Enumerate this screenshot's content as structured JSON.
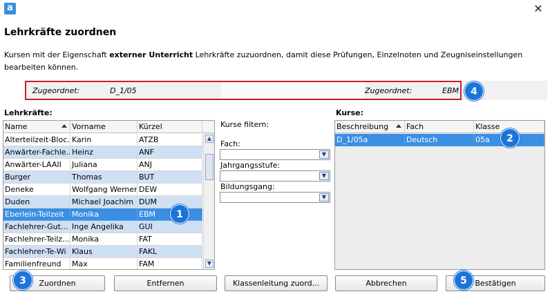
{
  "window": {
    "title": "Lehrkräfte zuordnen",
    "logo_letter": "a",
    "close_symbol": "✕"
  },
  "description": {
    "prefix": "Kursen mit der Eigenschaft ",
    "emphasis": "externer Unterricht",
    "suffix": " Lehrkräfte zuzuordnen, damit diese Prüfungen, Einzelnoten und Zeugniseinstellungen bearbeiten können."
  },
  "assigned": {
    "left_label": "Zugeordnet:",
    "left_value": "D_1/05",
    "right_label": "Zugeordnet:",
    "right_value": "EBM"
  },
  "teachers": {
    "label": "Lehrkräfte:",
    "columns": [
      "Name",
      "Vorname",
      "Kürzel"
    ],
    "rows": [
      {
        "name": "Alterteilzeit-Bloc...",
        "vorname": "Karin",
        "kuerzel": "ATZB"
      },
      {
        "name": "Anwärter-Fachle...",
        "vorname": "Heinz",
        "kuerzel": "ANF"
      },
      {
        "name": "Anwärter-LAAII",
        "vorname": "Juliana",
        "kuerzel": "ANJ"
      },
      {
        "name": "Burger",
        "vorname": "Thomas",
        "kuerzel": "BUT"
      },
      {
        "name": "Deneke",
        "vorname": "Wolfgang Werner",
        "kuerzel": "DEW"
      },
      {
        "name": "Duden",
        "vorname": "Michael Joachim",
        "kuerzel": "DUM"
      },
      {
        "name": "Eberlein-Teilzeit",
        "vorname": "Monika",
        "kuerzel": "EBM"
      },
      {
        "name": "Fachlehrer-Gut...",
        "vorname": "Inge Angelika",
        "kuerzel": "GUI"
      },
      {
        "name": "Fachlehrer-Teilz...",
        "vorname": "Monika",
        "kuerzel": "FAT"
      },
      {
        "name": "Fachlehrer-Te-Wi",
        "vorname": "Klaus",
        "kuerzel": "FAKL"
      },
      {
        "name": "Familienfreund",
        "vorname": "Max",
        "kuerzel": "FAM"
      }
    ],
    "selected_index": 6
  },
  "filters": {
    "title": "Kurse filtern:",
    "fach_label": "Fach:",
    "fach_value": "",
    "jahrgang_label": "Jahrgangsstufe:",
    "jahrgang_value": "",
    "bildung_label": "Bildungsgang:",
    "bildung_value": ""
  },
  "courses": {
    "label": "Kurse:",
    "columns": [
      "Beschreibung",
      "Fach",
      "Klasse"
    ],
    "rows": [
      {
        "beschreibung": "D_1/05a",
        "fach": "Deutsch",
        "klasse": "05a"
      }
    ]
  },
  "buttons": {
    "zuordnen": "Zuordnen",
    "entfernen": "Entfernen",
    "klassenleitung": "Klassenleitung zuord...",
    "abbrechen": "Abbrechen",
    "bestaetigen": "Bestätigen"
  },
  "badges": [
    "1",
    "2",
    "3",
    "4",
    "5"
  ],
  "colors": {
    "selection": "#3a8fe4",
    "alt_row": "#cfe0f5",
    "badge": "#1b74d8",
    "highlight_border": "#c0202a"
  }
}
